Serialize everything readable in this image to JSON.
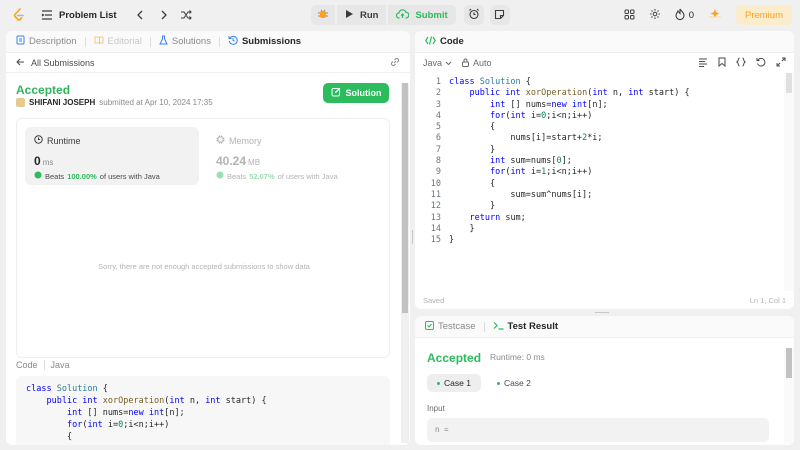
{
  "topbar": {
    "problem_list": "Problem List",
    "run": "Run",
    "submit": "Submit",
    "streak": "0",
    "premium": "Premium"
  },
  "left_panel": {
    "tabs": [
      "Description",
      "Editorial",
      "Solutions",
      "Submissions"
    ],
    "all_submissions": "All Submissions",
    "status": "Accepted",
    "author": "SHIFANI JOSEPH",
    "submitted_at": "submitted at Apr 10, 2024 17:35",
    "solution_button": "Solution",
    "runtime": {
      "title": "Runtime",
      "value": "0",
      "unit": "ms",
      "beats_pre": "Beats",
      "beats": "100.00%",
      "beats_post": "of users with Java"
    },
    "memory": {
      "title": "Memory",
      "value": "40.24",
      "unit": "MB",
      "beats_pre": "Beats",
      "beats": "52.07%",
      "beats_post": "of users with Java"
    },
    "no_data": "Sorry, there are not enough accepted submissions to show data",
    "code_label": "Code",
    "code_lang": "Java"
  },
  "editor": {
    "title": "Code",
    "language": "Java",
    "format": "Auto",
    "saved": "Saved",
    "cursor": "Ln 1, Col 1",
    "line_numbers": [
      "1",
      "2",
      "3",
      "4",
      "5",
      "6",
      "7",
      "8",
      "9",
      "10",
      "11",
      "12",
      "13",
      "14",
      "15"
    ]
  },
  "result": {
    "tab_testcase": "Testcase",
    "tab_result": "Test Result",
    "status": "Accepted",
    "runtime": "Runtime: 0 ms",
    "cases": [
      "Case 1",
      "Case 2"
    ],
    "input_label": "Input",
    "input_value": "n ="
  },
  "colors": {
    "accent_green": "#2cbb5d",
    "premium": "#ffa116"
  }
}
